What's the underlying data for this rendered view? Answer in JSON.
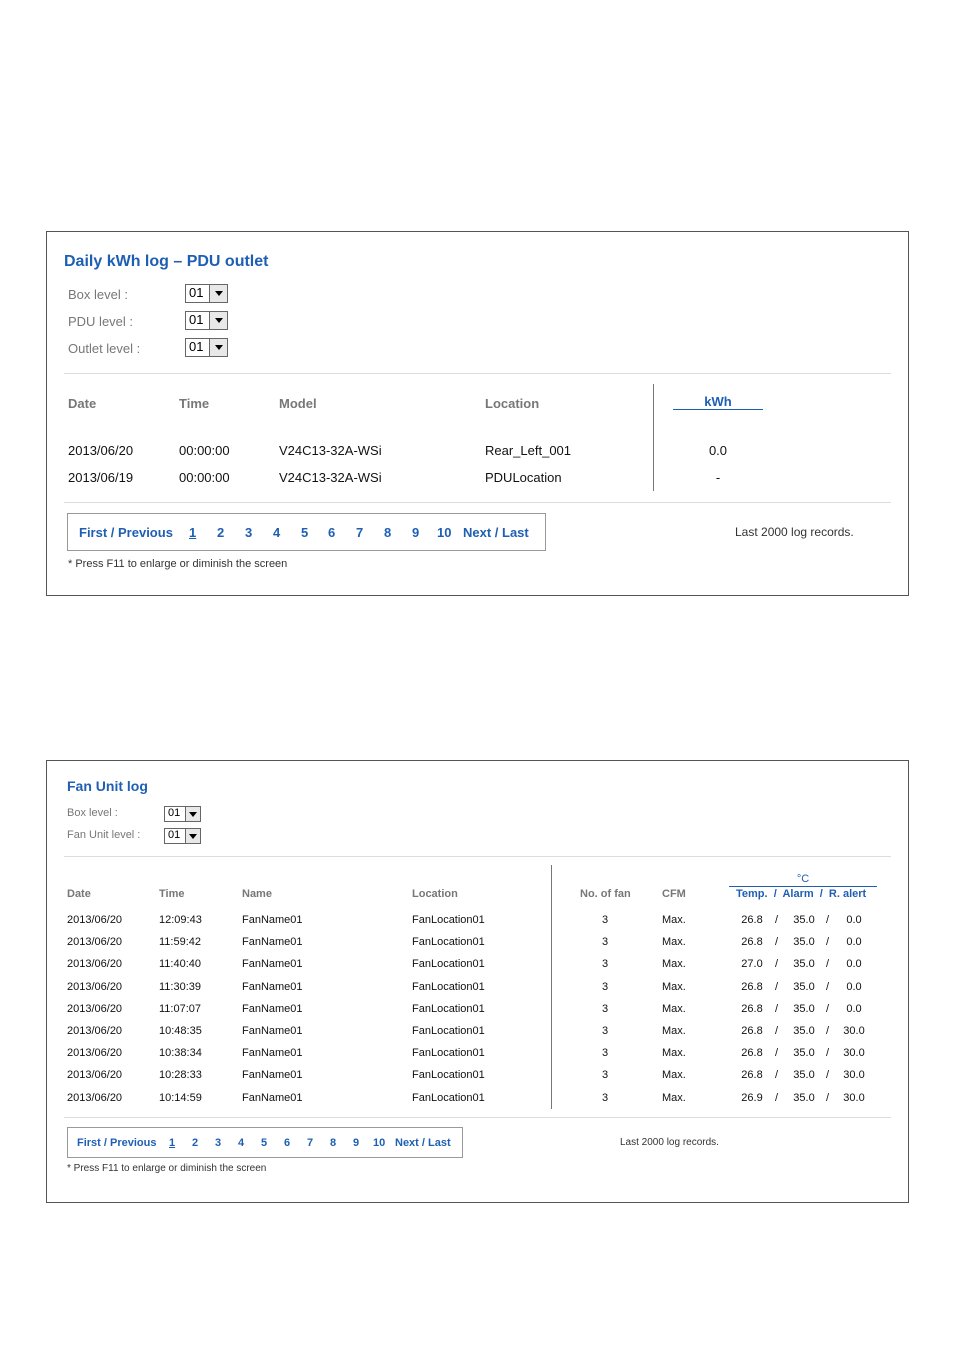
{
  "kwh": {
    "title": "Daily  kWh  log  –  PDU  outlet",
    "filters": [
      {
        "label": "Box level :",
        "value": "01"
      },
      {
        "label": "PDU level :",
        "value": "01"
      },
      {
        "label": "Outlet level :",
        "value": "01"
      }
    ],
    "columns": {
      "date": "Date",
      "time": "Time",
      "model": "Model",
      "location": "Location",
      "kwh": "kWh"
    },
    "rows": [
      {
        "date": "2013/06/20",
        "time": "00:00:00",
        "model": "V24C13-32A-WSi",
        "location": "Rear_Left_001",
        "kwh": "0.0"
      },
      {
        "date": "2013/06/19",
        "time": "00:00:00",
        "model": "V24C13-32A-WSi",
        "location": "PDULocation",
        "kwh": "-"
      }
    ],
    "pager": {
      "first_prev": "First / Previous",
      "pages": [
        "1",
        "2",
        "3",
        "4",
        "5",
        "6",
        "7",
        "8",
        "9",
        "10"
      ],
      "next_last": "Next / Last",
      "current": "1"
    },
    "records": "Last 2000 log records.",
    "note": "* Press F11 to enlarge or diminish the screen"
  },
  "fan": {
    "title": "Fan  Unit  log",
    "filters": [
      {
        "label": "Box level :",
        "value": "01"
      },
      {
        "label": "Fan Unit level :",
        "value": "01"
      }
    ],
    "columns": {
      "date": "Date",
      "time": "Time",
      "name": "Name",
      "location": "Location",
      "nofan": "No. of fan",
      "cfm": "CFM",
      "unit": "°C",
      "temp": "Temp.  /  Alarm  /  R. alert"
    },
    "rows": [
      {
        "date": "2013/06/20",
        "time": "12:09:43",
        "name": "FanName01",
        "location": "FanLocation01",
        "nofan": "3",
        "cfm": "Max.",
        "temp": "26.8",
        "alarm": "35.0",
        "ralert": "0.0"
      },
      {
        "date": "2013/06/20",
        "time": "11:59:42",
        "name": "FanName01",
        "location": "FanLocation01",
        "nofan": "3",
        "cfm": "Max.",
        "temp": "26.8",
        "alarm": "35.0",
        "ralert": "0.0"
      },
      {
        "date": "2013/06/20",
        "time": "11:40:40",
        "name": "FanName01",
        "location": "FanLocation01",
        "nofan": "3",
        "cfm": "Max.",
        "temp": "27.0",
        "alarm": "35.0",
        "ralert": "0.0"
      },
      {
        "date": "2013/06/20",
        "time": "11:30:39",
        "name": "FanName01",
        "location": "FanLocation01",
        "nofan": "3",
        "cfm": "Max.",
        "temp": "26.8",
        "alarm": "35.0",
        "ralert": "0.0"
      },
      {
        "date": "2013/06/20",
        "time": "11:07:07",
        "name": "FanName01",
        "location": "FanLocation01",
        "nofan": "3",
        "cfm": "Max.",
        "temp": "26.8",
        "alarm": "35.0",
        "ralert": "0.0"
      },
      {
        "date": "2013/06/20",
        "time": "10:48:35",
        "name": "FanName01",
        "location": "FanLocation01",
        "nofan": "3",
        "cfm": "Max.",
        "temp": "26.8",
        "alarm": "35.0",
        "ralert": "30.0"
      },
      {
        "date": "2013/06/20",
        "time": "10:38:34",
        "name": "FanName01",
        "location": "FanLocation01",
        "nofan": "3",
        "cfm": "Max.",
        "temp": "26.8",
        "alarm": "35.0",
        "ralert": "30.0"
      },
      {
        "date": "2013/06/20",
        "time": "10:28:33",
        "name": "FanName01",
        "location": "FanLocation01",
        "nofan": "3",
        "cfm": "Max.",
        "temp": "26.8",
        "alarm": "35.0",
        "ralert": "30.0"
      },
      {
        "date": "2013/06/20",
        "time": "10:14:59",
        "name": "FanName01",
        "location": "FanLocation01",
        "nofan": "3",
        "cfm": "Max.",
        "temp": "26.9",
        "alarm": "35.0",
        "ralert": "30.0"
      }
    ],
    "pager": {
      "first_prev": "First / Previous",
      "pages": [
        "1",
        "2",
        "3",
        "4",
        "5",
        "6",
        "7",
        "8",
        "9",
        "10"
      ],
      "next_last": "Next / Last",
      "current": "1"
    },
    "records": "Last 2000 log records.",
    "note": "* Press F11 to enlarge or diminish the screen"
  },
  "colors": {
    "accent": "#1f5fb3",
    "label": "#777777",
    "border": "#555555"
  }
}
